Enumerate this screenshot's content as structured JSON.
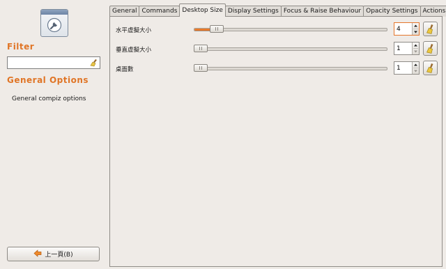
{
  "sidebar": {
    "filter_title": "Filter",
    "filter_value": "",
    "options_title": "General Options",
    "plugin_description": "General compiz options",
    "back_label": "上一頁(B)"
  },
  "tabs": [
    {
      "label": "General",
      "active": false
    },
    {
      "label": "Commands",
      "active": false
    },
    {
      "label": "Desktop Size",
      "active": true
    },
    {
      "label": "Display Settings",
      "active": false
    },
    {
      "label": "Focus & Raise Behaviour",
      "active": false
    },
    {
      "label": "Opacity Settings",
      "active": false
    },
    {
      "label": "Actions",
      "active": false
    }
  ],
  "settings": [
    {
      "label": "水平虛擬大小",
      "value": "4",
      "slider_fraction": 0.09,
      "focused": true
    },
    {
      "label": "垂直虛擬大小",
      "value": "1",
      "slider_fraction": 0.0,
      "focused": false
    },
    {
      "label": "桌面數",
      "value": "1",
      "slider_fraction": 0.0,
      "focused": false
    }
  ],
  "colors": {
    "accent": "#e07526",
    "background": "#efebe7"
  },
  "icons": {
    "app": "settings-wrench-icon",
    "clear": "broom-icon",
    "reset": "broom-icon",
    "back": "arrow-left-icon"
  }
}
